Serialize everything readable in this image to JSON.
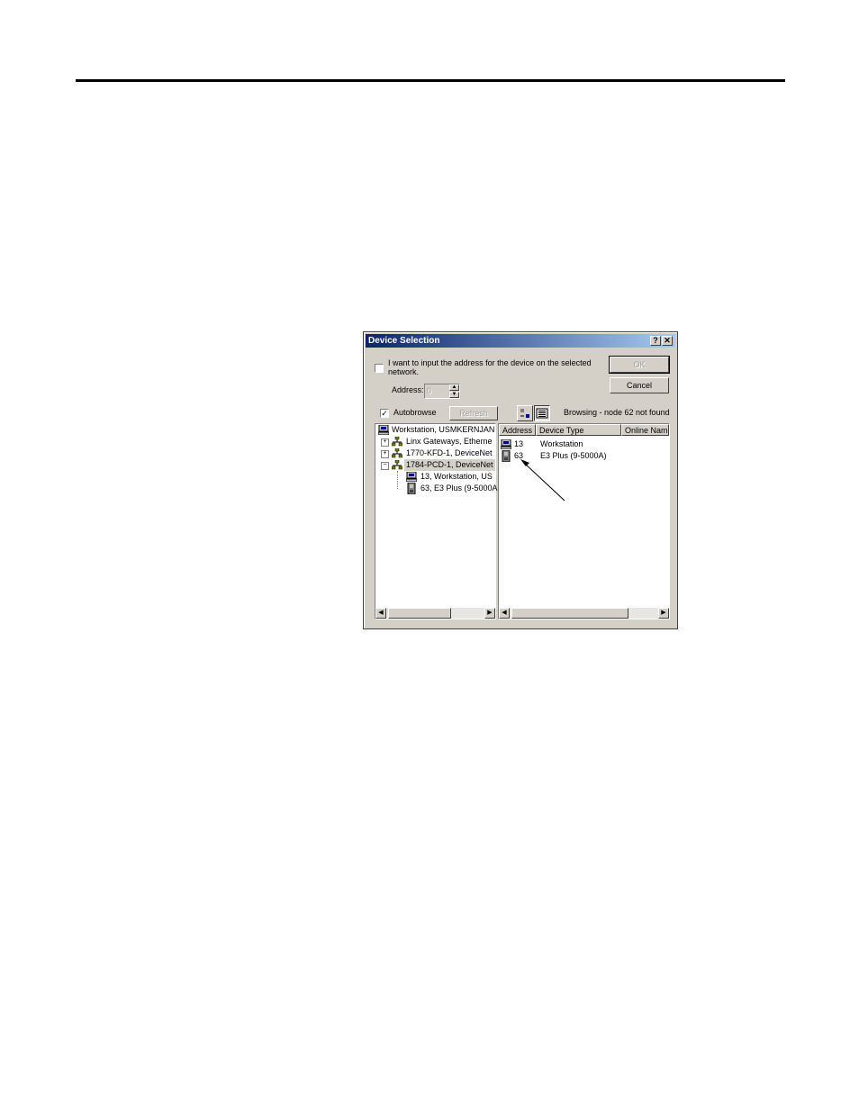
{
  "dialog": {
    "title": "Device Selection",
    "help_glyph": "?",
    "close_glyph": "✕",
    "manual_address_checkbox": {
      "checked": false,
      "label_line1": "I want to input the address for the device on the selected",
      "label_line2": "network."
    },
    "address_label": "Address:",
    "address_value": "0",
    "ok_label": "OK",
    "cancel_label": "Cancel",
    "autobrowse": {
      "checked": true,
      "label": "Autobrowse"
    },
    "refresh_label": "Refresh",
    "status_text": "Browsing - node 62 not found",
    "tree": {
      "items": [
        {
          "label": "Workstation, USMKERNJAN"
        },
        {
          "label": "Linx Gateways, Etherne"
        },
        {
          "label": "1770-KFD-1, DeviceNet"
        },
        {
          "label": "1784-PCD-1, DeviceNet"
        },
        {
          "label": "13, Workstation, US"
        },
        {
          "label": "63, E3 Plus (9-5000A"
        }
      ]
    },
    "list": {
      "columns": [
        "Address",
        "Device Type",
        "Online Nam"
      ],
      "rows": [
        {
          "address": "13",
          "device_type": "Workstation"
        },
        {
          "address": "63",
          "device_type": "E3 Plus (9-5000A)"
        }
      ]
    },
    "icons": {
      "workstation": "computer-icon",
      "network": "network-icon",
      "device": "device-icon"
    }
  }
}
